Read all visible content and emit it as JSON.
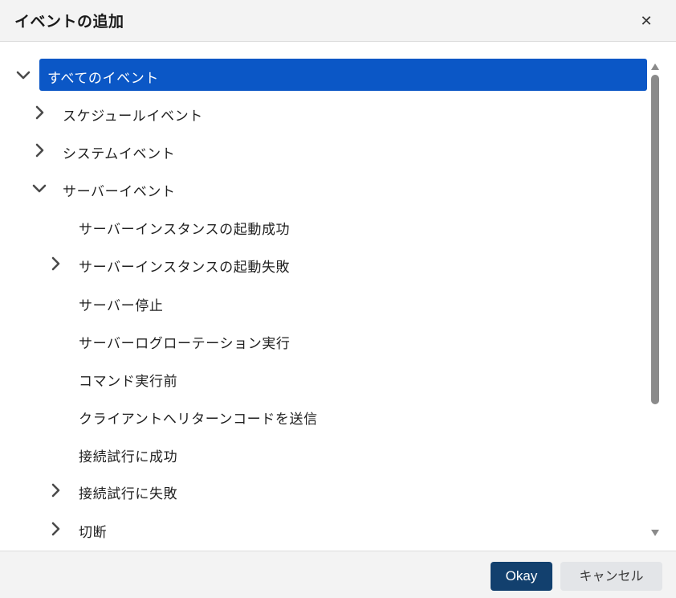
{
  "dialog": {
    "title": "イベントの追加",
    "close_glyph": "✕"
  },
  "tree": {
    "items": [
      {
        "label": "すべてのイベント",
        "expander": "chevron-down",
        "selected": true
      },
      {
        "label": "スケジュールイベント",
        "expander": "chevron-right",
        "selected": false
      },
      {
        "label": "システムイベント",
        "expander": "chevron-right",
        "selected": false
      },
      {
        "label": "サーバーイベント",
        "expander": "chevron-down",
        "selected": false
      },
      {
        "label": "サーバーインスタンスの起動成功",
        "expander": "none",
        "selected": false
      },
      {
        "label": "サーバーインスタンスの起動失敗",
        "expander": "chevron-right",
        "selected": false
      },
      {
        "label": "サーバー停止",
        "expander": "none",
        "selected": false
      },
      {
        "label": "サーバーログローテーション実行",
        "expander": "none",
        "selected": false
      },
      {
        "label": "コマンド実行前",
        "expander": "none",
        "selected": false
      },
      {
        "label": "クライアントへリターンコードを送信",
        "expander": "none",
        "selected": false
      },
      {
        "label": "接続試行に成功",
        "expander": "none",
        "selected": false
      },
      {
        "label": "接続試行に失敗",
        "expander": "chevron-right",
        "selected": false
      },
      {
        "label": "切断",
        "expander": "chevron-right",
        "selected": false
      }
    ]
  },
  "footer": {
    "ok_label": "Okay",
    "cancel_label": "キャンセル"
  },
  "colors": {
    "selection": "#0b57c6",
    "ok_button": "#12406e",
    "cancel_button": "#e3e5e8",
    "chevron": "#4a4a4a"
  }
}
